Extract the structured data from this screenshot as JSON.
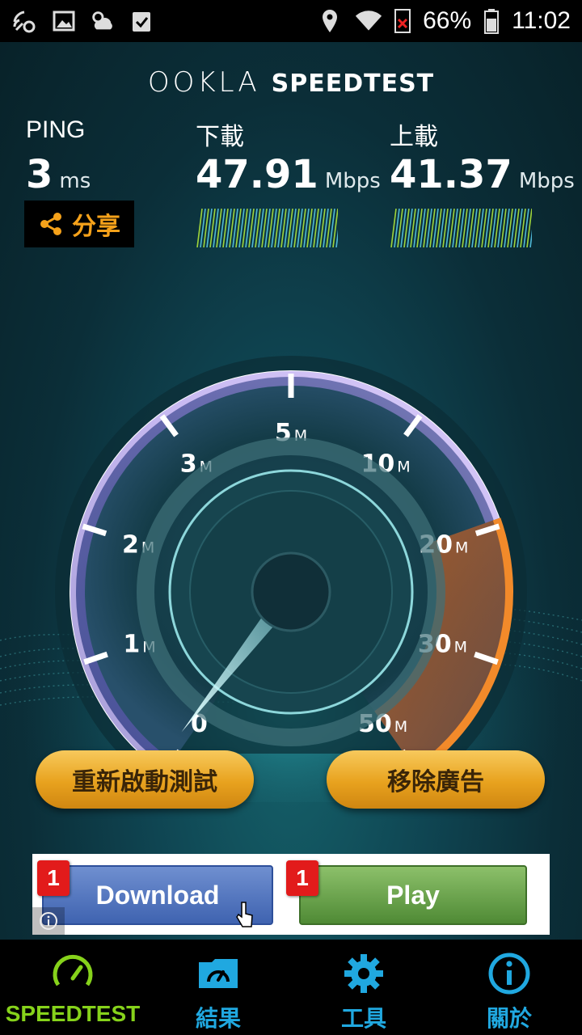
{
  "status_bar": {
    "battery_percent": "66%",
    "time": "11:02",
    "left_icons": [
      "wifi-calling-icon",
      "image-icon",
      "weather-icon",
      "clipboard-check-icon"
    ],
    "right_icons": [
      "location-icon",
      "wifi-icon",
      "no-sim-icon",
      "battery-icon"
    ]
  },
  "app": {
    "logo_brand": "OOKLA",
    "logo_product": "SPEEDTEST"
  },
  "results": {
    "ping_label": "PING",
    "ping_value": "3",
    "ping_unit": "ms",
    "download_label": "下載",
    "download_value": "47.91",
    "download_unit": "Mbps",
    "upload_label": "上載",
    "upload_value": "41.37",
    "upload_unit": "Mbps",
    "share_label": "分享"
  },
  "gauge": {
    "ticks": [
      {
        "label": "0",
        "unit": ""
      },
      {
        "label": "1",
        "unit": "M"
      },
      {
        "label": "2",
        "unit": "M"
      },
      {
        "label": "3",
        "unit": "M"
      },
      {
        "label": "5",
        "unit": "M"
      },
      {
        "label": "10",
        "unit": "M"
      },
      {
        "label": "20",
        "unit": "M"
      },
      {
        "label": "30",
        "unit": "M"
      },
      {
        "label": "50",
        "unit": "M"
      }
    ],
    "needle_value_mbps": 0
  },
  "actions": {
    "restart_label": "重新啟動測試",
    "remove_ads_label": "移除廣告"
  },
  "ad": {
    "download_label": "Download",
    "play_label": "Play",
    "badge_count": "1"
  },
  "nav": {
    "items": [
      {
        "label": "SPEEDTEST",
        "icon": "speedometer-icon"
      },
      {
        "label": "結果",
        "icon": "results-folder-icon"
      },
      {
        "label": "工具",
        "icon": "gear-icon"
      },
      {
        "label": "關於",
        "icon": "info-icon"
      }
    ],
    "active_color": "#86d21b",
    "inactive_color": "#20a8e0"
  },
  "colors": {
    "accent_orange": "#f6a21a",
    "upload_bars": "#9fd43a",
    "gauge_purple": "#8a6fd8"
  }
}
